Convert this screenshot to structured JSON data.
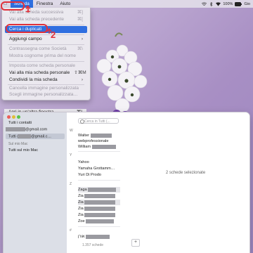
{
  "menubar": {
    "apple": "",
    "items": [
      "Scheda",
      "Finestra",
      "Aiuto"
    ],
    "battery": "100%",
    "day": "Gio"
  },
  "menu": {
    "items": [
      {
        "label": "Vai alla scheda successiva",
        "shortcut": "⌘]",
        "disabled": true
      },
      {
        "label": "Vai alla scheda precedente",
        "shortcut": "⌘[",
        "disabled": true
      },
      {
        "label": "Cerca i duplicati",
        "shortcut": "",
        "disabled": false
      },
      {
        "label": "Aggiungi campo",
        "shortcut": "›",
        "disabled": false
      },
      {
        "label": "Contrassegna come Società",
        "shortcut": "⌘\\",
        "disabled": true
      },
      {
        "label": "Mostra cognome prima del nome",
        "shortcut": "",
        "disabled": true
      },
      {
        "label": "Imposta come scheda personale",
        "shortcut": "",
        "disabled": true
      },
      {
        "label": "Vai alla mia scheda personale",
        "shortcut": "⇧⌘M",
        "disabled": false
      },
      {
        "label": "Condividi la mia scheda",
        "shortcut": "›",
        "disabled": false
      },
      {
        "label": "Cancella immagine personalizzata",
        "shortcut": "",
        "disabled": true
      },
      {
        "label": "Scegli immagine personalizzata…",
        "shortcut": "",
        "disabled": true
      },
      {
        "label": "Apri in un'altra finestra",
        "shortcut": "⌘I",
        "disabled": false
      }
    ]
  },
  "annotations": {
    "one": "1",
    "two": "2"
  },
  "sidebar": {
    "all_contacts": "Tutti i contatti",
    "account1": "@gmail.com",
    "account2_prefix": "Tutti (",
    "account2_suffix": "@gmail.c…",
    "section_mac": "Sul mio Mac",
    "all_on_mac": "Tutti sul mio Mac"
  },
  "search": {
    "placeholder": "Cerca in Tutti (..."
  },
  "contacts": {
    "groups": [
      {
        "letter": "W",
        "names": [
          "Walter",
          "webprofessionale",
          "William"
        ]
      },
      {
        "letter": "Y",
        "names": [
          "Yahoo",
          "Yamaha Grottamm…",
          "Yuri Di Prodo"
        ]
      },
      {
        "letter": "Z",
        "names": [
          "Zaga",
          "Zia",
          "Zia",
          "Zia",
          "Zia",
          "Zoe"
        ]
      },
      {
        "letter": "#",
        "names": [
          "אורן"
        ]
      }
    ],
    "count": "1.357 schede"
  },
  "detail": {
    "message": "2 schede selezionate",
    "add": "+"
  }
}
